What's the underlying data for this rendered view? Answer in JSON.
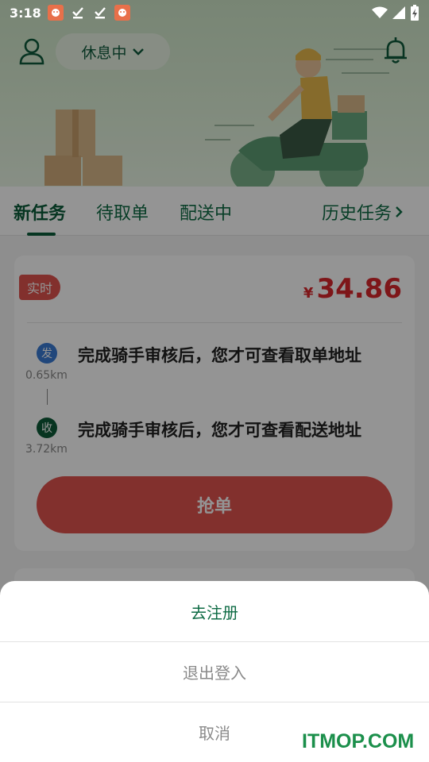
{
  "status_bar": {
    "time": "3:18",
    "icons": [
      "app-notification-icon",
      "download-done-icon",
      "download-done-icon",
      "app-notification-icon",
      "wifi-icon",
      "signal-icon",
      "battery-icon"
    ]
  },
  "header": {
    "work_status": "休息中"
  },
  "tabs": [
    {
      "label": "新任务",
      "active": true
    },
    {
      "label": "待取单",
      "active": false
    },
    {
      "label": "配送中",
      "active": false
    }
  ],
  "history_tab": {
    "label": "历史任务"
  },
  "order": {
    "badge": "实时",
    "currency": "¥",
    "price": "34.86",
    "pickup": {
      "icon": "发",
      "distance": "0.65km",
      "address": "完成骑手审核后，您才可查看取单地址"
    },
    "delivery": {
      "icon": "收",
      "distance": "3.72km",
      "address": "完成骑手审核后，您才可查看配送地址"
    },
    "grab_label": "抢单"
  },
  "sheet": {
    "register": "去注册",
    "logout": "退出登入",
    "cancel": "取消"
  },
  "watermark": "ITMOP.COM",
  "colors": {
    "brand_green": "#0b5c3a",
    "price_red": "#d9262b",
    "badge_red": "#e0534f",
    "overlay": "rgba(0,0,0,0.42)"
  }
}
